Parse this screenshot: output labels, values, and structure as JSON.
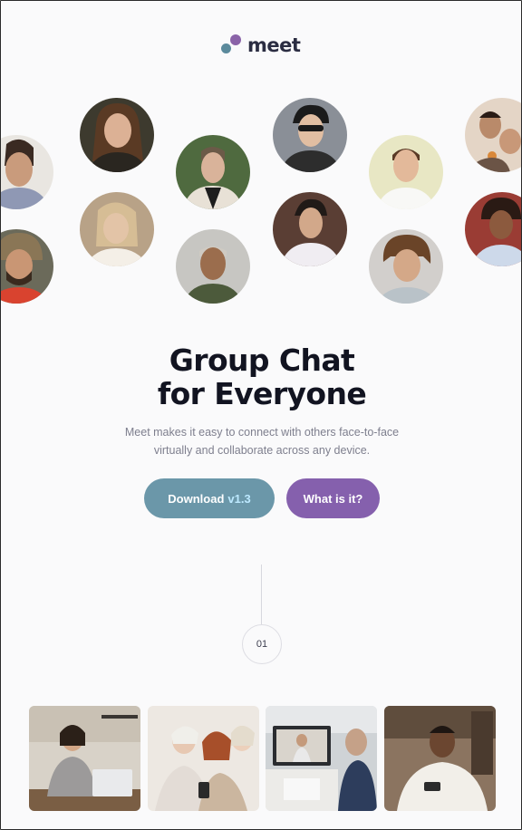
{
  "logo": {
    "text": "meet",
    "icon": "meet-logo-icon"
  },
  "avatars": [
    "portrait-1",
    "portrait-2",
    "portrait-3",
    "portrait-4",
    "portrait-5",
    "portrait-6",
    "portrait-7",
    "portrait-8",
    "portrait-9",
    "portrait-10",
    "portrait-11",
    "portrait-12"
  ],
  "hero": {
    "title_line1": "Group Chat",
    "title_line2": "for Everyone",
    "subtitle_line1": "Meet makes it easy to connect with others face-to-face",
    "subtitle_line2": "virtually and collaborate across any device."
  },
  "buttons": {
    "download_label": "Download",
    "download_version": "v1.3",
    "what_label": "What is it?"
  },
  "step": {
    "number": "01"
  },
  "colors": {
    "accent_teal": "#6b97a9",
    "accent_purple": "#8560ad",
    "title": "#121421",
    "body_text": "#7e7f8e",
    "background": "#fafafb"
  }
}
